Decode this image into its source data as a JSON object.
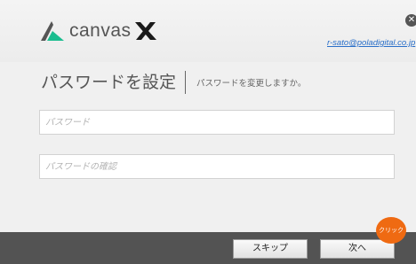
{
  "app": {
    "logo_text": "canvas",
    "logo_icon": "canvas-x-logo"
  },
  "header": {
    "user_email": "r-sato@poladigital.co.jp",
    "close_icon": "close-icon"
  },
  "main": {
    "title": "パスワードを設定",
    "subtitle": "パスワードを変更しますか。",
    "password_placeholder": "パスワード",
    "confirm_placeholder": "パスワードの確認"
  },
  "footer": {
    "skip_label": "スキップ",
    "next_label": "次へ"
  },
  "annotation": {
    "click_label": "クリック"
  },
  "colors": {
    "footer_bg": "#535353",
    "email_link": "#2a6fc9",
    "click_badge": "#ef6a12"
  }
}
